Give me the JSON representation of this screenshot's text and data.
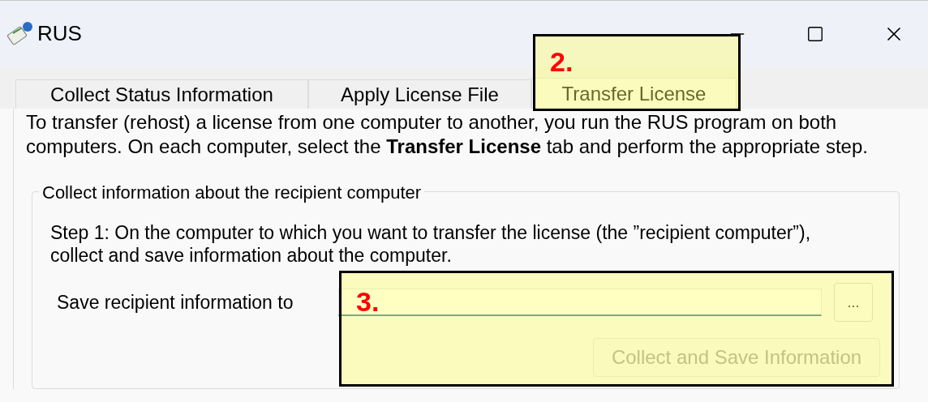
{
  "window": {
    "title": "RUS"
  },
  "tabs": [
    {
      "label": "Collect Status Information",
      "selected": false
    },
    {
      "label": "Apply License File",
      "selected": false
    },
    {
      "label": "Transfer License",
      "selected": true
    }
  ],
  "intro": "To transfer (rehost) a license from one computer to another, you run the RUS program on both computers. On each computer, select the **Transfer License** tab and perform the appropriate step.",
  "group": {
    "title": "Collect information about the recipient computer",
    "step": "Step 1: On the computer to which you want to transfer the license (the ”recipient computer”), collect and save information about the computer.",
    "field_label": "Save recipient information to",
    "browse_button": {
      "label": "...",
      "disabled": false
    },
    "collect_button": {
      "label": "Collect and Save Information",
      "disabled": true
    }
  },
  "callouts": [
    {
      "label": "2."
    },
    {
      "label": "3."
    }
  ]
}
